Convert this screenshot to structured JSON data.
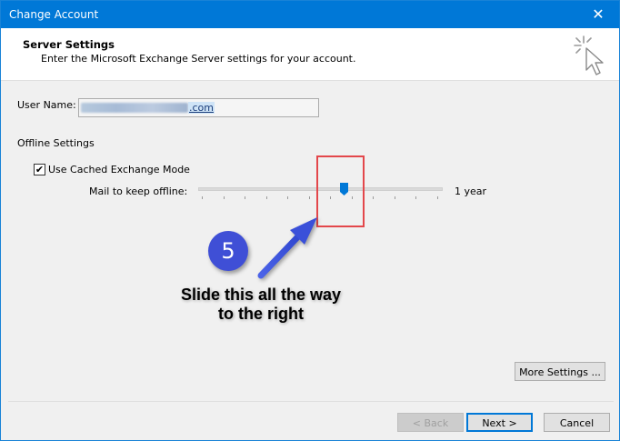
{
  "window": {
    "title": "Change Account",
    "close_symbol": "✕"
  },
  "header": {
    "title": "Server Settings",
    "subtitle": "Enter the Microsoft Exchange Server settings for your account.",
    "icon": "wizard-cursor-icon"
  },
  "user": {
    "label": "User Name:",
    "value_visible_suffix": ".com"
  },
  "offline": {
    "section_label": "Offline Settings",
    "cached_mode": {
      "label": "Use Cached Exchange Mode",
      "checked": true,
      "check_symbol": "✔"
    },
    "mail_label": "Mail to keep offline:",
    "slider": {
      "value_label": "1 year",
      "position_fraction": 0.6,
      "ticks": 12
    }
  },
  "annotation": {
    "step_number": "5",
    "text_line1": "Slide this all the way",
    "text_line2": "to the right",
    "circle_color": "#3f4fd6",
    "highlight_color": "#e3474b"
  },
  "buttons": {
    "more_settings": "More Settings ...",
    "back": "< Back",
    "next": "Next >",
    "cancel": "Cancel"
  },
  "colors": {
    "titlebar": "#0078d7",
    "accent": "#0078d7"
  }
}
